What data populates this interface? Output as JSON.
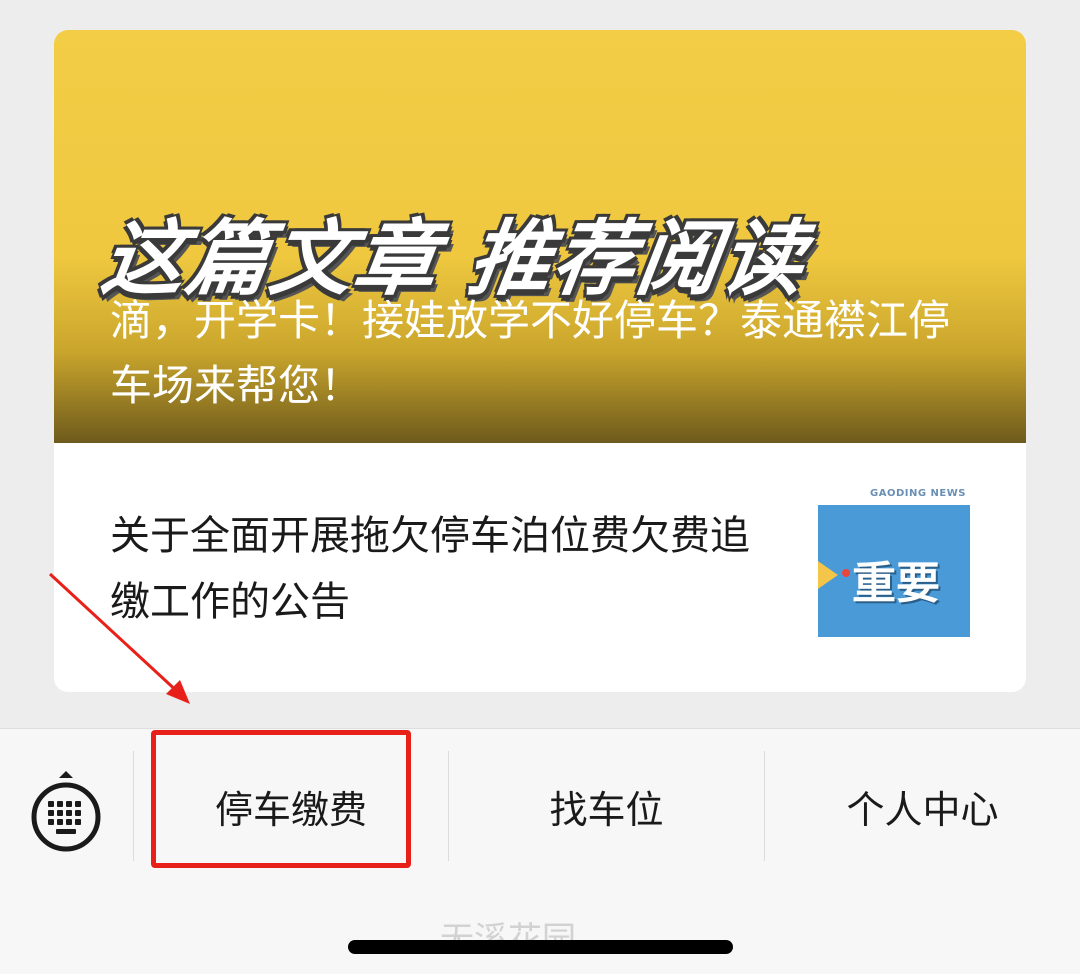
{
  "banner": {
    "headline": "这篇文章 推荐阅读",
    "title": "滴，开学卡！接娃放学不好停车？泰通襟江停车场来帮您！"
  },
  "article": {
    "title": "关于全面开展拖欠停车泊位费欠费追缴工作的公告",
    "thumbnail": {
      "source_label": "GAODING NEWS",
      "label": "重要"
    }
  },
  "menu": {
    "keyboard_icon": "keyboard-icon",
    "items": [
      {
        "label": "停车缴费"
      },
      {
        "label": "找车位"
      },
      {
        "label": "个人中心"
      }
    ]
  },
  "annotation": {
    "highlight_color": "#e8201a"
  },
  "watermark": "无溪花园"
}
